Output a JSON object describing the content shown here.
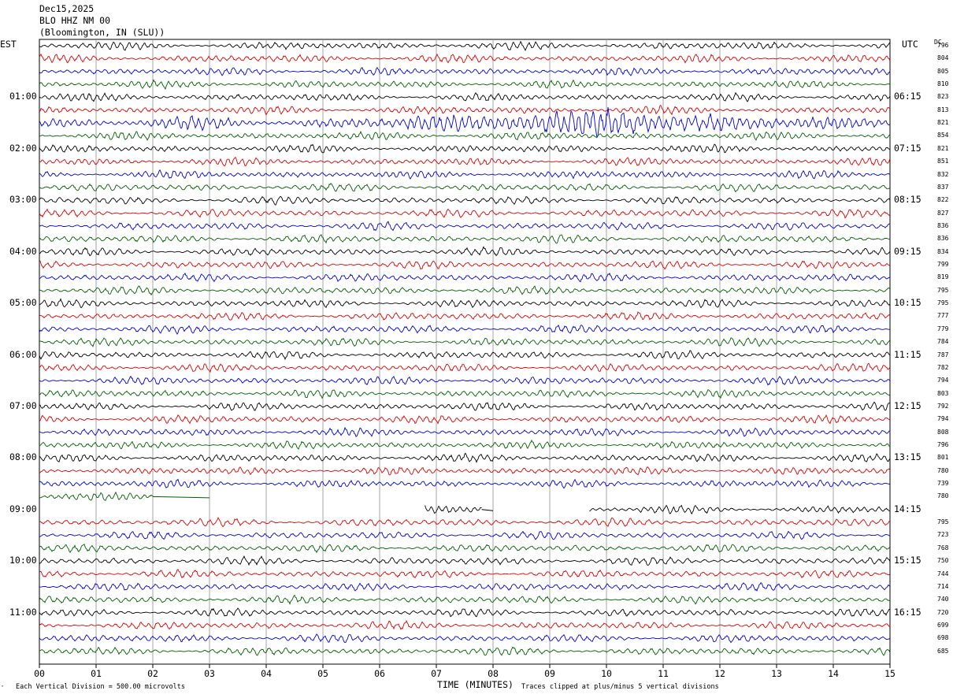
{
  "header": {
    "date": "Dec15,2025",
    "station": "BLO HHZ NM 00",
    "location": "(Bloomington, IN (SLU))"
  },
  "labels": {
    "left_zone": "EST",
    "right_zone": "UTC",
    "dc": "DC"
  },
  "footer": {
    "scale": "Each Vertical Division =  500.00 microvolts",
    "clip": "Traces clipped at plus/minus 5 vertical divisions"
  },
  "colors": {
    "trace_cycle": [
      "#000000",
      "#e00000",
      "#0000e0",
      "#006000"
    ],
    "grid": "#909090"
  },
  "chart_data": {
    "type": "line",
    "title": "BLO HHZ NM 00",
    "xlabel": "TIME (MINUTES)",
    "ylabel": "",
    "xlim": [
      0,
      15
    ],
    "x_ticks": [
      "00",
      "01",
      "02",
      "03",
      "04",
      "05",
      "06",
      "07",
      "08",
      "09",
      "10",
      "11",
      "12",
      "13",
      "14",
      "15"
    ],
    "rows": [
      {
        "left": "",
        "right": "",
        "dc": "796",
        "amp": 1.0
      },
      {
        "left": "",
        "right": "",
        "dc": "804",
        "amp": 1.0
      },
      {
        "left": "",
        "right": "",
        "dc": "805",
        "amp": 1.0
      },
      {
        "left": "",
        "right": "",
        "dc": "810",
        "amp": 1.0
      },
      {
        "left": "01:00",
        "right": "06:15",
        "dc": "823",
        "amp": 1.0
      },
      {
        "left": "",
        "right": "",
        "dc": "813",
        "amp": 1.0
      },
      {
        "left": "",
        "right": "",
        "dc": "821",
        "amp": 1.6,
        "burst": [
          6.5,
          13.0
        ]
      },
      {
        "left": "",
        "right": "",
        "dc": "854",
        "amp": 1.0
      },
      {
        "left": "02:00",
        "right": "07:15",
        "dc": "821",
        "amp": 1.0
      },
      {
        "left": "",
        "right": "",
        "dc": "851",
        "amp": 1.0
      },
      {
        "left": "",
        "right": "",
        "dc": "832",
        "amp": 1.0
      },
      {
        "left": "",
        "right": "",
        "dc": "837",
        "amp": 1.0
      },
      {
        "left": "03:00",
        "right": "08:15",
        "dc": "822",
        "amp": 1.0
      },
      {
        "left": "",
        "right": "",
        "dc": "827",
        "amp": 1.0
      },
      {
        "left": "",
        "right": "",
        "dc": "836",
        "amp": 1.0
      },
      {
        "left": "",
        "right": "",
        "dc": "836",
        "amp": 1.0
      },
      {
        "left": "04:00",
        "right": "09:15",
        "dc": "834",
        "amp": 1.0
      },
      {
        "left": "",
        "right": "",
        "dc": "799",
        "amp": 1.0
      },
      {
        "left": "",
        "right": "",
        "dc": "819",
        "amp": 1.0
      },
      {
        "left": "",
        "right": "",
        "dc": "795",
        "amp": 1.0
      },
      {
        "left": "05:00",
        "right": "10:15",
        "dc": "795",
        "amp": 1.0
      },
      {
        "left": "",
        "right": "",
        "dc": "777",
        "amp": 1.0
      },
      {
        "left": "",
        "right": "",
        "dc": "779",
        "amp": 1.0
      },
      {
        "left": "",
        "right": "",
        "dc": "784",
        "amp": 1.0
      },
      {
        "left": "06:00",
        "right": "11:15",
        "dc": "787",
        "amp": 1.0
      },
      {
        "left": "",
        "right": "",
        "dc": "782",
        "amp": 1.0
      },
      {
        "left": "",
        "right": "",
        "dc": "794",
        "amp": 1.0
      },
      {
        "left": "",
        "right": "",
        "dc": "803",
        "amp": 1.0
      },
      {
        "left": "07:00",
        "right": "12:15",
        "dc": "792",
        "amp": 1.0
      },
      {
        "left": "",
        "right": "",
        "dc": "794",
        "amp": 1.0
      },
      {
        "left": "",
        "right": "",
        "dc": "808",
        "amp": 1.0
      },
      {
        "left": "",
        "right": "",
        "dc": "796",
        "amp": 1.0
      },
      {
        "left": "08:00",
        "right": "13:15",
        "dc": "801",
        "amp": 1.0
      },
      {
        "left": "",
        "right": "",
        "dc": "780",
        "amp": 1.0
      },
      {
        "left": "",
        "right": "",
        "dc": "739",
        "amp": 1.0
      },
      {
        "left": "",
        "right": "",
        "dc": "780",
        "amp": 1.0,
        "segments": [
          [
            0,
            2.0
          ]
        ],
        "flat": [
          2.0,
          3.0
        ]
      },
      {
        "left": "09:00",
        "right": "14:15",
        "dc": "",
        "amp": 1.0,
        "segments": [
          [
            6.8,
            7.8
          ],
          [
            9.7,
            15
          ]
        ],
        "flat": [
          7.8,
          8.0
        ]
      },
      {
        "left": "",
        "right": "",
        "dc": "795",
        "amp": 1.0
      },
      {
        "left": "",
        "right": "",
        "dc": "723",
        "amp": 1.0
      },
      {
        "left": "",
        "right": "",
        "dc": "768",
        "amp": 1.0
      },
      {
        "left": "10:00",
        "right": "15:15",
        "dc": "750",
        "amp": 1.0
      },
      {
        "left": "",
        "right": "",
        "dc": "744",
        "amp": 1.0
      },
      {
        "left": "",
        "right": "",
        "dc": "714",
        "amp": 1.0
      },
      {
        "left": "",
        "right": "",
        "dc": "740",
        "amp": 1.0
      },
      {
        "left": "11:00",
        "right": "16:15",
        "dc": "720",
        "amp": 1.0
      },
      {
        "left": "",
        "right": "",
        "dc": "699",
        "amp": 1.0
      },
      {
        "left": "",
        "right": "",
        "dc": "698",
        "amp": 1.0
      },
      {
        "left": "",
        "right": "",
        "dc": "685",
        "amp": 1.0
      }
    ]
  }
}
